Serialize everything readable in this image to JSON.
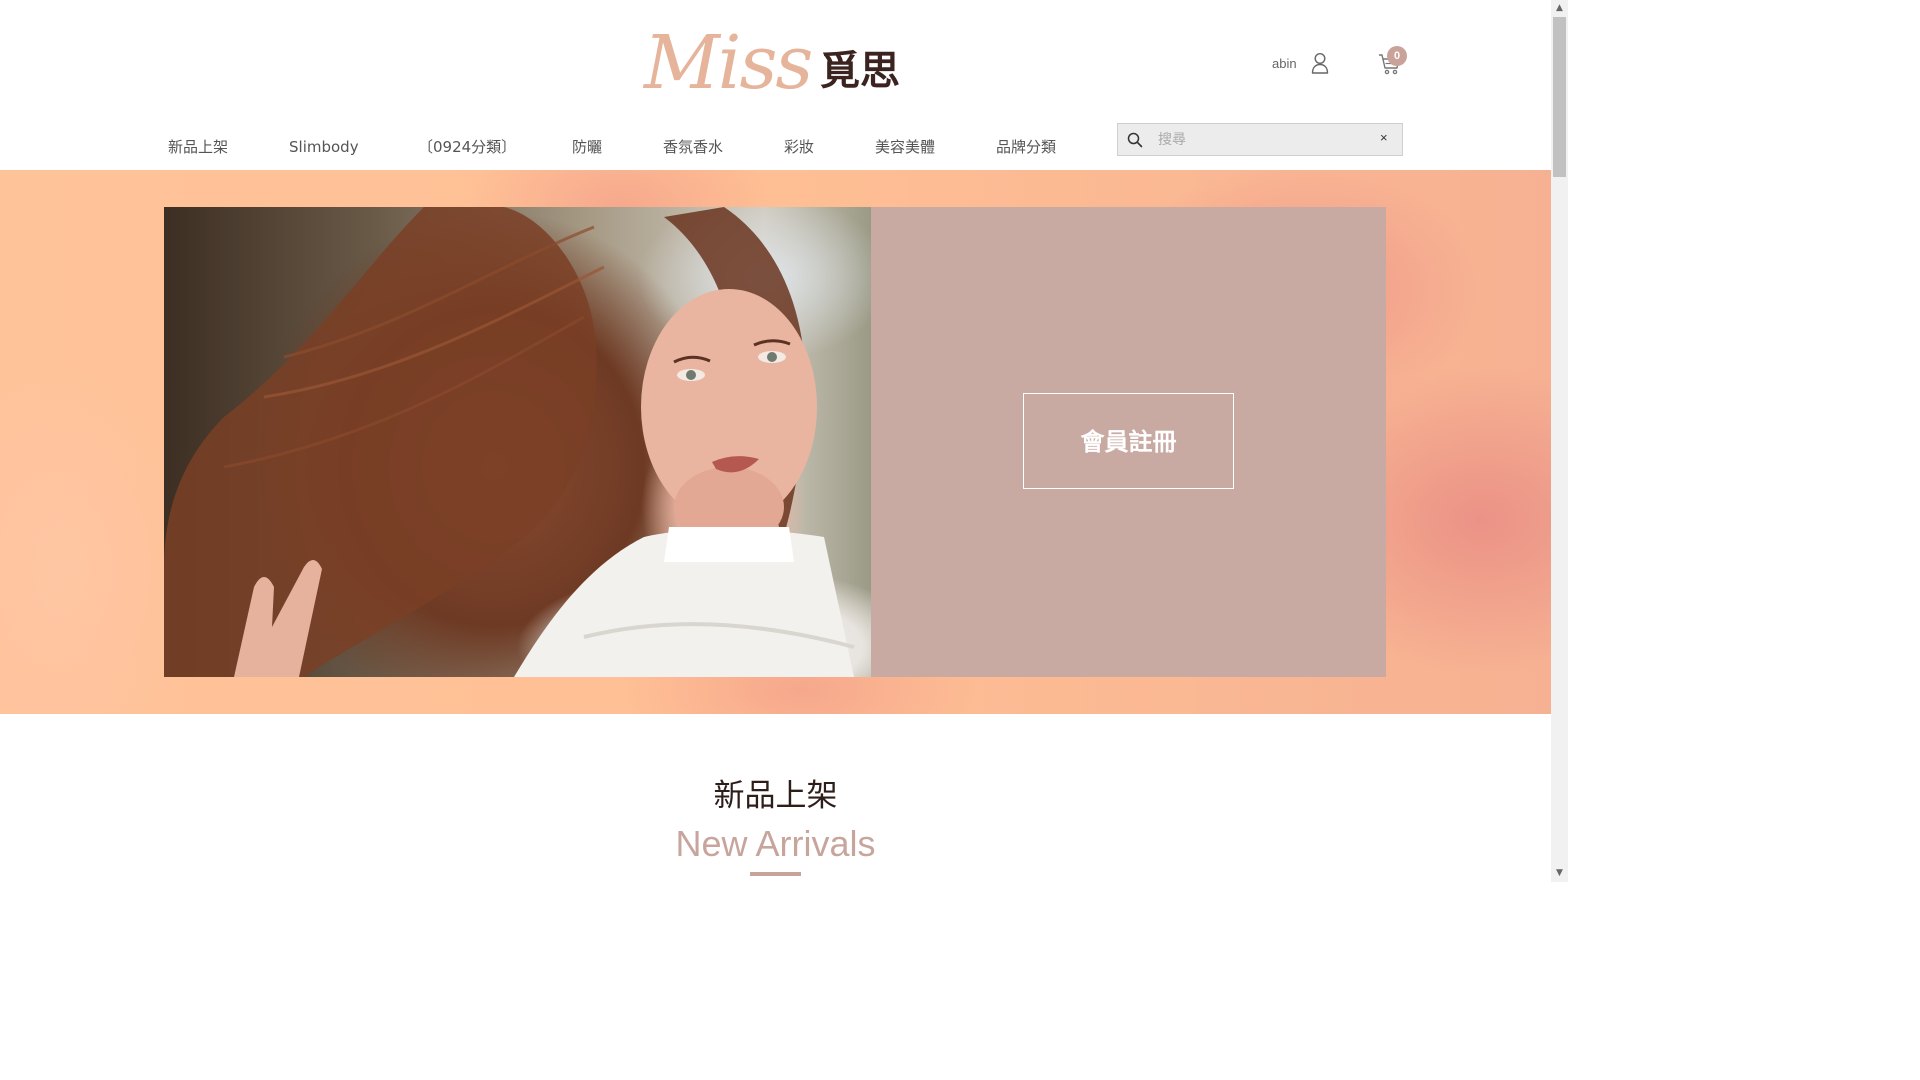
{
  "header": {
    "logo_script": "Miss",
    "logo_cjk": "覓思",
    "user_name": "abin",
    "cart_count": "0"
  },
  "nav": {
    "items": [
      {
        "label": "新品上架"
      },
      {
        "label": "Slimbody"
      },
      {
        "label": "〔0924分類〕"
      },
      {
        "label": "防曬"
      },
      {
        "label": "香氛香水"
      },
      {
        "label": "彩妝"
      },
      {
        "label": "美容美體"
      },
      {
        "label": "品牌分類"
      }
    ]
  },
  "search": {
    "placeholder": "搜尋",
    "clear_label": "×"
  },
  "hero": {
    "register_label": "會員註冊"
  },
  "section": {
    "title": "新品上架",
    "subtitle": "New Arrivals"
  },
  "scrollbar": {
    "up": "▲",
    "down": "▼"
  },
  "colors": {
    "accent": "#c9a29a",
    "panel": "#c9aaa3",
    "logo_script": "#e6b49a",
    "logo_cjk": "#3b2320",
    "hero_bg": "#ffc39a"
  }
}
